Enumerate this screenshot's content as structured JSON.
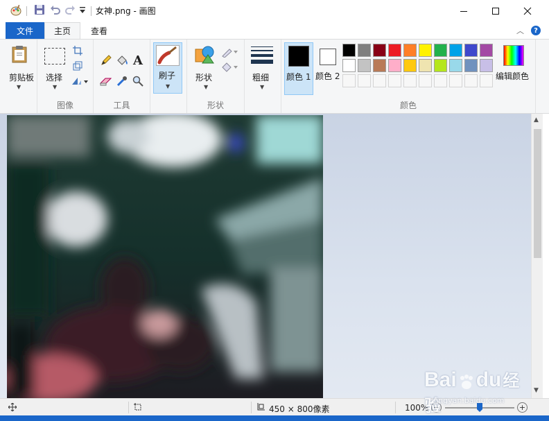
{
  "window": {
    "title": "女神.png - 画图",
    "controls": {
      "minimize": "minimize-icon",
      "maximize": "maximize-icon",
      "close": "close-icon"
    }
  },
  "quick_access": [
    "paint-app-icon",
    "save-icon",
    "undo-icon",
    "redo-icon",
    "customize-dropdown-icon"
  ],
  "tabs": {
    "file": "文件",
    "home": "主页",
    "view": "查看",
    "help_icon": "?"
  },
  "ribbon": {
    "clipboard": {
      "label": "剪贴板"
    },
    "image": {
      "label": "图像",
      "select": "选择"
    },
    "tools": {
      "label": "工具"
    },
    "brushes": {
      "label": "刷子"
    },
    "shapes": {
      "label": "形状",
      "group_label": "形状"
    },
    "size": {
      "label": "粗细"
    },
    "color1": {
      "label": "颜色 1",
      "value": "#000000"
    },
    "color2": {
      "label": "颜色 2",
      "value": "#ffffff"
    },
    "edit_colors": "编辑颜色",
    "colors_group": "颜色",
    "palette_row1": [
      "#000000",
      "#7f7f7f",
      "#880015",
      "#ed1c24",
      "#ff7f27",
      "#fff200",
      "#22b14c",
      "#00a2e8",
      "#3f48cc",
      "#a349a4"
    ],
    "palette_row2": [
      "#ffffff",
      "#c3c3c3",
      "#b97a57",
      "#ffaec9",
      "#ffc90e",
      "#efe4b0",
      "#b5e61d",
      "#99d9ea",
      "#7092be",
      "#c8bfe7"
    ]
  },
  "status": {
    "dimensions": "450 × 800像素",
    "zoom": "100%",
    "zoom_level": 0.5
  },
  "watermark": {
    "brand": "Bai",
    "brand2": "du",
    "suffix": "经验",
    "url": "jingyan.baidu.com"
  }
}
